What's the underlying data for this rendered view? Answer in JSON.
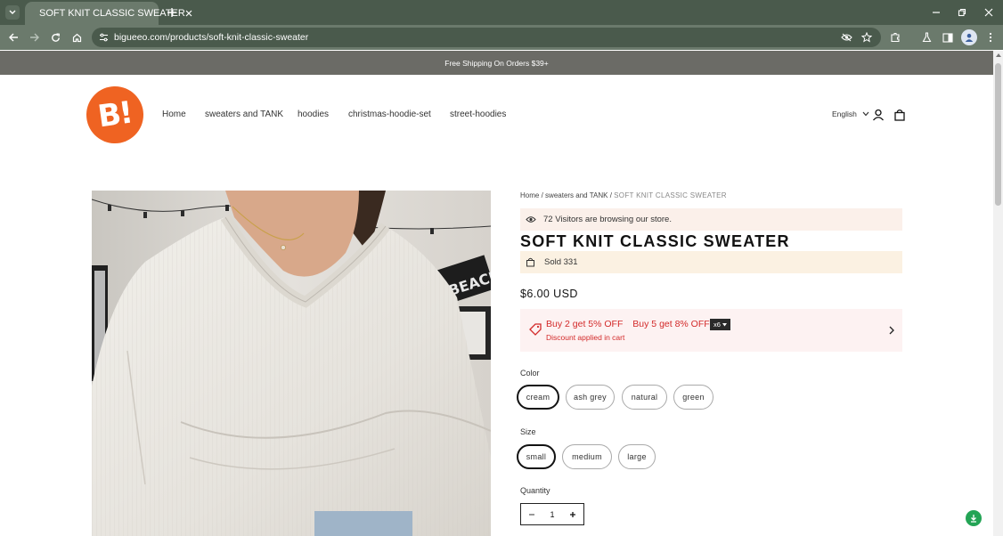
{
  "browser": {
    "tab_title": "SOFT KNIT CLASSIC SWEATER",
    "url": "bigueeo.com/products/soft-knit-classic-sweater"
  },
  "announcement": "Free Shipping On Orders $39+",
  "header": {
    "logo_text": "B!",
    "nav": [
      "Home",
      "sweaters and TANK",
      "hoodies",
      "christmas-hoodie-set",
      "street-hoodies"
    ],
    "language": "English"
  },
  "product": {
    "breadcrumb": {
      "home": "Home",
      "sep1": "/",
      "category": "sweaters and TANK",
      "sep2": "/",
      "current": "SOFT KNIT CLASSIC SWEATER"
    },
    "visitors_text": "72 Visitors are browsing our store.",
    "title": "SOFT KNIT CLASSIC SWEATER",
    "sold_text": "Sold 331",
    "price": "$6.00 USD",
    "promo": {
      "offer1": "Buy 2 get 5% OFF",
      "offer2": "Buy 5 get 8% OFF",
      "badge": "x6",
      "subtext": "Discount applied in cart"
    },
    "color": {
      "label": "Color",
      "options": [
        "cream",
        "ash grey",
        "natural",
        "green"
      ],
      "selected": "cream"
    },
    "size": {
      "label": "Size",
      "options": [
        "small",
        "medium",
        "large"
      ],
      "selected": "small"
    },
    "quantity": {
      "label": "Quantity",
      "value": "1"
    }
  },
  "colors": {
    "brand_orange": "#ef6322",
    "promo_red": "#d32a2a",
    "chrome_green": "#6b7a6c"
  }
}
